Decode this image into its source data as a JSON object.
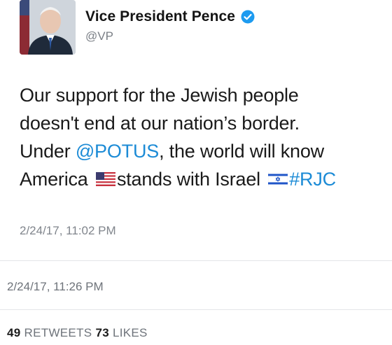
{
  "tweet": {
    "author_name": "Vice President Pence",
    "handle": "@VP",
    "verified_icon": "verified-badge-icon",
    "text_parts": {
      "line1": "Our support for the Jewish people",
      "line2": "doesn't end at our nation’s border.",
      "line3_prefix": "Under ",
      "mention": "@POTUS",
      "line3_suffix": ", the world will know",
      "line4_a": "America ",
      "us_flag_icon": "us-flag-icon",
      "line4_b": "stands with Israel ",
      "israel_flag_icon": "israel-flag-icon",
      "hashtag": "#RJC"
    },
    "timestamp": "2/24/17, 11:02 PM"
  },
  "retweet_timestamp": "2/24/17, 11:26 PM",
  "stats": {
    "retweets_count": "49",
    "retweets_label": "RETWEETS",
    "likes_count": "73",
    "likes_label": "LIKES"
  },
  "colors": {
    "link": "#1c8bd6",
    "verified": "#1d9bf0",
    "secondary_text": "#7a7f86"
  }
}
